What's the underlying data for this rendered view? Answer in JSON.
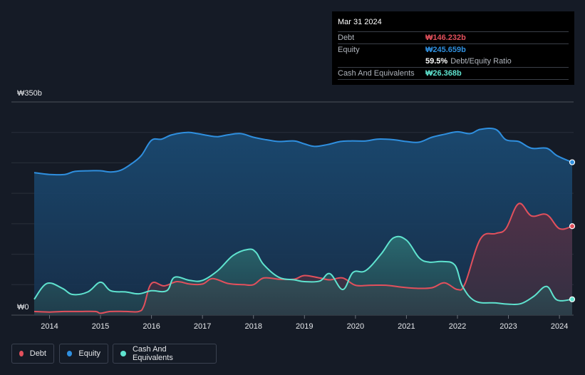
{
  "tooltip": {
    "date": "Mar 31 2024",
    "debt_label": "Debt",
    "debt_value": "₩146.232b",
    "equity_label": "Equity",
    "equity_value": "₩245.659b",
    "ratio_value": "59.5%",
    "ratio_label": "Debt/Equity Ratio",
    "cash_label": "Cash And Equivalents",
    "cash_value": "₩26.368b"
  },
  "legend": [
    {
      "label": "Debt",
      "color": "#e2505c"
    },
    {
      "label": "Equity",
      "color": "#2f8fdf"
    },
    {
      "label": "Cash And Equivalents",
      "color": "#5fe3cf"
    }
  ],
  "chart_data": {
    "type": "area",
    "y_top_label": "₩350b",
    "y_bottom_label": "₩0",
    "ylim": [
      0,
      350
    ],
    "xlim": [
      2013.7,
      2024.25
    ],
    "x_ticks": [
      "2014",
      "2015",
      "2016",
      "2017",
      "2018",
      "2019",
      "2020",
      "2021",
      "2022",
      "2023",
      "2024"
    ],
    "grid": true,
    "legend_position": "bottom-left",
    "series": [
      {
        "name": "Equity",
        "color": "#2f8fdf",
        "points": [
          [
            2013.7,
            234
          ],
          [
            2014.0,
            231
          ],
          [
            2014.3,
            231
          ],
          [
            2014.5,
            236
          ],
          [
            2014.8,
            237
          ],
          [
            2015.0,
            237
          ],
          [
            2015.2,
            235
          ],
          [
            2015.4,
            238
          ],
          [
            2015.6,
            248
          ],
          [
            2015.8,
            262
          ],
          [
            2016.0,
            287
          ],
          [
            2016.2,
            289
          ],
          [
            2016.4,
            296
          ],
          [
            2016.7,
            300
          ],
          [
            2016.9,
            298
          ],
          [
            2017.1,
            295
          ],
          [
            2017.3,
            293
          ],
          [
            2017.5,
            296
          ],
          [
            2017.75,
            298
          ],
          [
            2018.0,
            292
          ],
          [
            2018.25,
            288
          ],
          [
            2018.5,
            285
          ],
          [
            2018.8,
            286
          ],
          [
            2019.0,
            281
          ],
          [
            2019.2,
            277
          ],
          [
            2019.45,
            280
          ],
          [
            2019.7,
            285
          ],
          [
            2019.9,
            286
          ],
          [
            2020.2,
            286
          ],
          [
            2020.45,
            289
          ],
          [
            2020.75,
            288
          ],
          [
            2021.0,
            285
          ],
          [
            2021.25,
            284
          ],
          [
            2021.5,
            292
          ],
          [
            2021.75,
            297
          ],
          [
            2022.0,
            301
          ],
          [
            2022.25,
            298
          ],
          [
            2022.45,
            305
          ],
          [
            2022.75,
            305
          ],
          [
            2022.95,
            288
          ],
          [
            2023.2,
            285
          ],
          [
            2023.45,
            274
          ],
          [
            2023.75,
            274
          ],
          [
            2023.95,
            262
          ],
          [
            2024.25,
            251
          ]
        ]
      },
      {
        "name": "Debt",
        "color": "#e2505c",
        "points": [
          [
            2013.7,
            6
          ],
          [
            2014.0,
            5
          ],
          [
            2014.3,
            6
          ],
          [
            2014.6,
            6
          ],
          [
            2014.9,
            6
          ],
          [
            2015.0,
            3
          ],
          [
            2015.2,
            6
          ],
          [
            2015.5,
            6
          ],
          [
            2015.75,
            6
          ],
          [
            2015.85,
            15
          ],
          [
            2016.0,
            52
          ],
          [
            2016.25,
            48
          ],
          [
            2016.5,
            55
          ],
          [
            2016.75,
            51
          ],
          [
            2017.0,
            51
          ],
          [
            2017.2,
            60
          ],
          [
            2017.5,
            52
          ],
          [
            2017.8,
            50
          ],
          [
            2018.0,
            50
          ],
          [
            2018.2,
            61
          ],
          [
            2018.5,
            59
          ],
          [
            2018.8,
            59
          ],
          [
            2019.0,
            65
          ],
          [
            2019.3,
            61
          ],
          [
            2019.5,
            58
          ],
          [
            2019.75,
            61
          ],
          [
            2020.0,
            49
          ],
          [
            2020.3,
            49
          ],
          [
            2020.6,
            49
          ],
          [
            2020.9,
            46
          ],
          [
            2021.2,
            44
          ],
          [
            2021.5,
            45
          ],
          [
            2021.75,
            53
          ],
          [
            2022.0,
            42
          ],
          [
            2022.15,
            52
          ],
          [
            2022.45,
            125
          ],
          [
            2022.75,
            134
          ],
          [
            2022.95,
            142
          ],
          [
            2023.2,
            183
          ],
          [
            2023.45,
            163
          ],
          [
            2023.75,
            165
          ],
          [
            2024.0,
            142
          ],
          [
            2024.25,
            146
          ]
        ]
      },
      {
        "name": "Cash And Equivalents",
        "color": "#5fe3cf",
        "points": [
          [
            2013.7,
            26
          ],
          [
            2013.95,
            52
          ],
          [
            2014.25,
            44
          ],
          [
            2014.45,
            34
          ],
          [
            2014.75,
            38
          ],
          [
            2015.0,
            54
          ],
          [
            2015.2,
            40
          ],
          [
            2015.5,
            38
          ],
          [
            2015.75,
            35
          ],
          [
            2016.0,
            40
          ],
          [
            2016.3,
            40
          ],
          [
            2016.45,
            62
          ],
          [
            2016.75,
            57
          ],
          [
            2017.0,
            57
          ],
          [
            2017.3,
            73
          ],
          [
            2017.6,
            98
          ],
          [
            2017.9,
            108
          ],
          [
            2018.05,
            103
          ],
          [
            2018.2,
            83
          ],
          [
            2018.5,
            62
          ],
          [
            2018.8,
            58
          ],
          [
            2019.0,
            55
          ],
          [
            2019.3,
            56
          ],
          [
            2019.5,
            68
          ],
          [
            2019.75,
            42
          ],
          [
            2019.95,
            70
          ],
          [
            2020.2,
            73
          ],
          [
            2020.5,
            100
          ],
          [
            2020.75,
            127
          ],
          [
            2021.0,
            123
          ],
          [
            2021.25,
            94
          ],
          [
            2021.45,
            87
          ],
          [
            2021.7,
            88
          ],
          [
            2021.95,
            82
          ],
          [
            2022.1,
            47
          ],
          [
            2022.35,
            23
          ],
          [
            2022.75,
            20
          ],
          [
            2023.0,
            18
          ],
          [
            2023.25,
            19
          ],
          [
            2023.5,
            31
          ],
          [
            2023.75,
            47
          ],
          [
            2023.95,
            25
          ],
          [
            2024.25,
            26
          ]
        ]
      }
    ]
  }
}
